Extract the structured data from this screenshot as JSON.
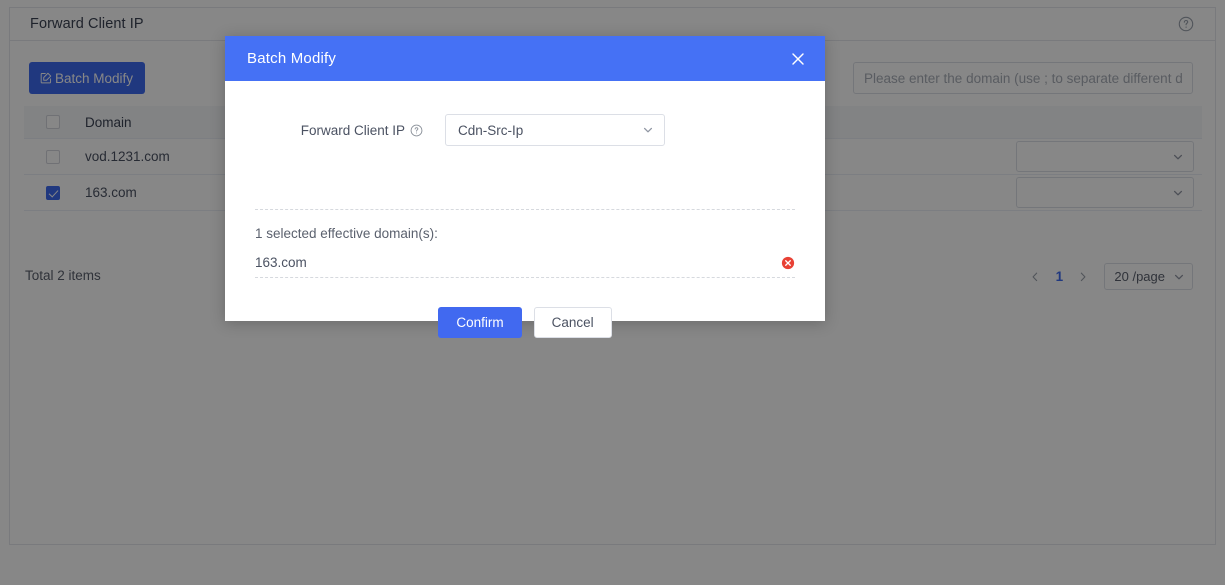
{
  "page": {
    "title": "Forward Client IP",
    "help_icon": "question-circle-icon"
  },
  "toolbar": {
    "batch_modify_label": "Batch Modify",
    "batch_modify_icon": "edit-square-icon",
    "search_placeholder": "Please enter the domain (use ; to separate different domains)",
    "search_value": ""
  },
  "table": {
    "columns": [
      "Domain"
    ],
    "rows": [
      {
        "domain": "vod.1231.com",
        "checked": false,
        "select_value": ""
      },
      {
        "domain": "163.com",
        "checked": true,
        "select_value": ""
      }
    ],
    "header_checked": false,
    "total_label": "Total 2 items"
  },
  "pagination": {
    "prev_icon": "chevron-left-icon",
    "next_icon": "chevron-right-icon",
    "current_page": "1",
    "page_size_label": "20 /page",
    "page_size_icon": "chevron-down-icon"
  },
  "modal": {
    "title": "Batch Modify",
    "close_icon": "close-icon",
    "field": {
      "label": "Forward Client IP",
      "help_icon": "question-circle-icon",
      "select_value": "Cdn-Src-Ip",
      "select_icon": "chevron-down-icon"
    },
    "selected_label": "1 selected effective domain(s):",
    "selected_domains": [
      {
        "name": "163.com",
        "remove_icon": "remove-circle-icon"
      }
    ],
    "confirm_label": "Confirm",
    "cancel_label": "Cancel"
  },
  "colors": {
    "modal_header_blue": "#4571f5",
    "primary_blue": "#4169f0",
    "button_blue": "#3d6af0",
    "remove_red": "#e84135",
    "overlay": "rgba(0,0,0,0.47)"
  }
}
